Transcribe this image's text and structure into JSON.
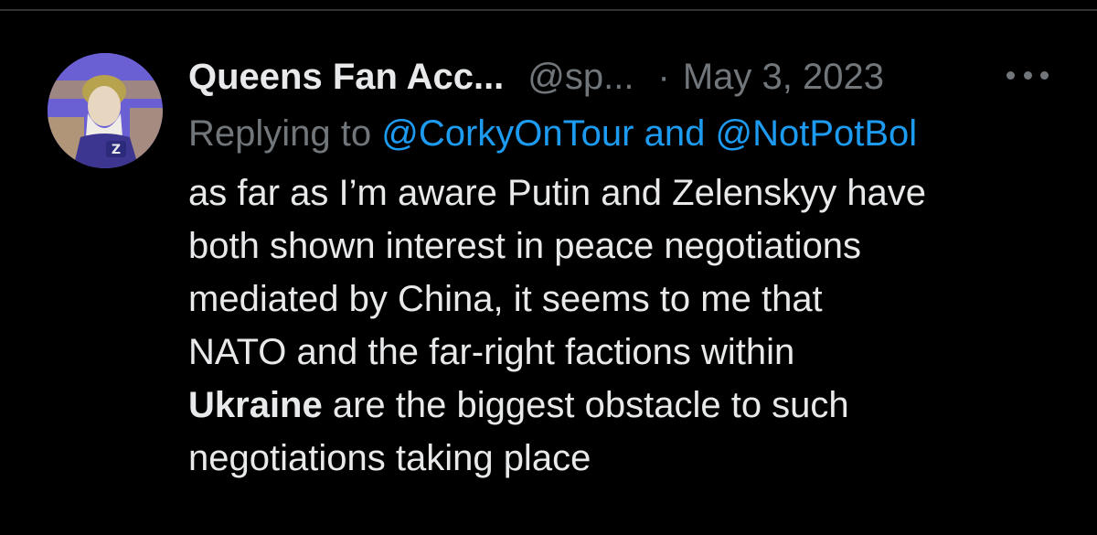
{
  "tweet": {
    "display_name": "Queens Fan Acc...",
    "handle": "@sp...",
    "separator": "·",
    "date": "May 3, 2023",
    "more_label": "•••",
    "reply": {
      "prefix": "Replying to",
      "mention_1": "@CorkyOnTour",
      "conjunction": "and",
      "mention_2": "@NotPotBol"
    },
    "text_lines": [
      "as far as I’m aware Putin and Zelenskyy have",
      "both shown interest in peace negotiations",
      "mediated by China, it seems to me that",
      "NATO and the far-right factions within"
    ],
    "line5_bold": "Ukraine",
    "line5_rest": " are the biggest obstacle to such",
    "line6": "negotiations taking place"
  },
  "colors": {
    "background": "#000000",
    "primary_text": "#e7e9ea",
    "secondary_text": "#71767b",
    "link": "#1d9bf0",
    "divider": "#2f3336"
  },
  "icons": {
    "avatar": "profile-photo",
    "more": "more-horizontal-icon"
  }
}
